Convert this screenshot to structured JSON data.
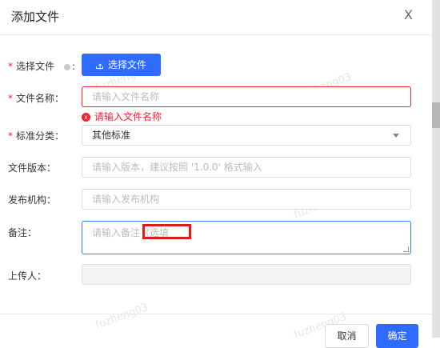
{
  "dialog": {
    "title": "添加文件",
    "close_glyph": "X"
  },
  "form": {
    "file": {
      "label": "选择文件",
      "required": "*",
      "button": "选择文件"
    },
    "name": {
      "label": "文件名称：",
      "required": "*",
      "placeholder": "请输入文件名称",
      "error": "请输入文件名称",
      "error_icon": "x"
    },
    "category": {
      "label": "标准分类：",
      "required": "*",
      "value": "其他标准"
    },
    "version": {
      "label": "文件版本：",
      "placeholder": "请输入版本，建议按照 '1.0.0' 格式输入"
    },
    "org": {
      "label": "发布机构：",
      "placeholder": "请输入发布机构"
    },
    "remark": {
      "label": "备注：",
      "placeholder": "请输入备注（选填"
    },
    "uploader": {
      "label": "上传人："
    }
  },
  "footer": {
    "cancel": "取消",
    "confirm": "确定"
  },
  "watermark": {
    "text": "fuzheng03"
  },
  "colors": {
    "primary": "#2f6bff",
    "error": "#f5222d",
    "highlight": "#e01b1b"
  }
}
